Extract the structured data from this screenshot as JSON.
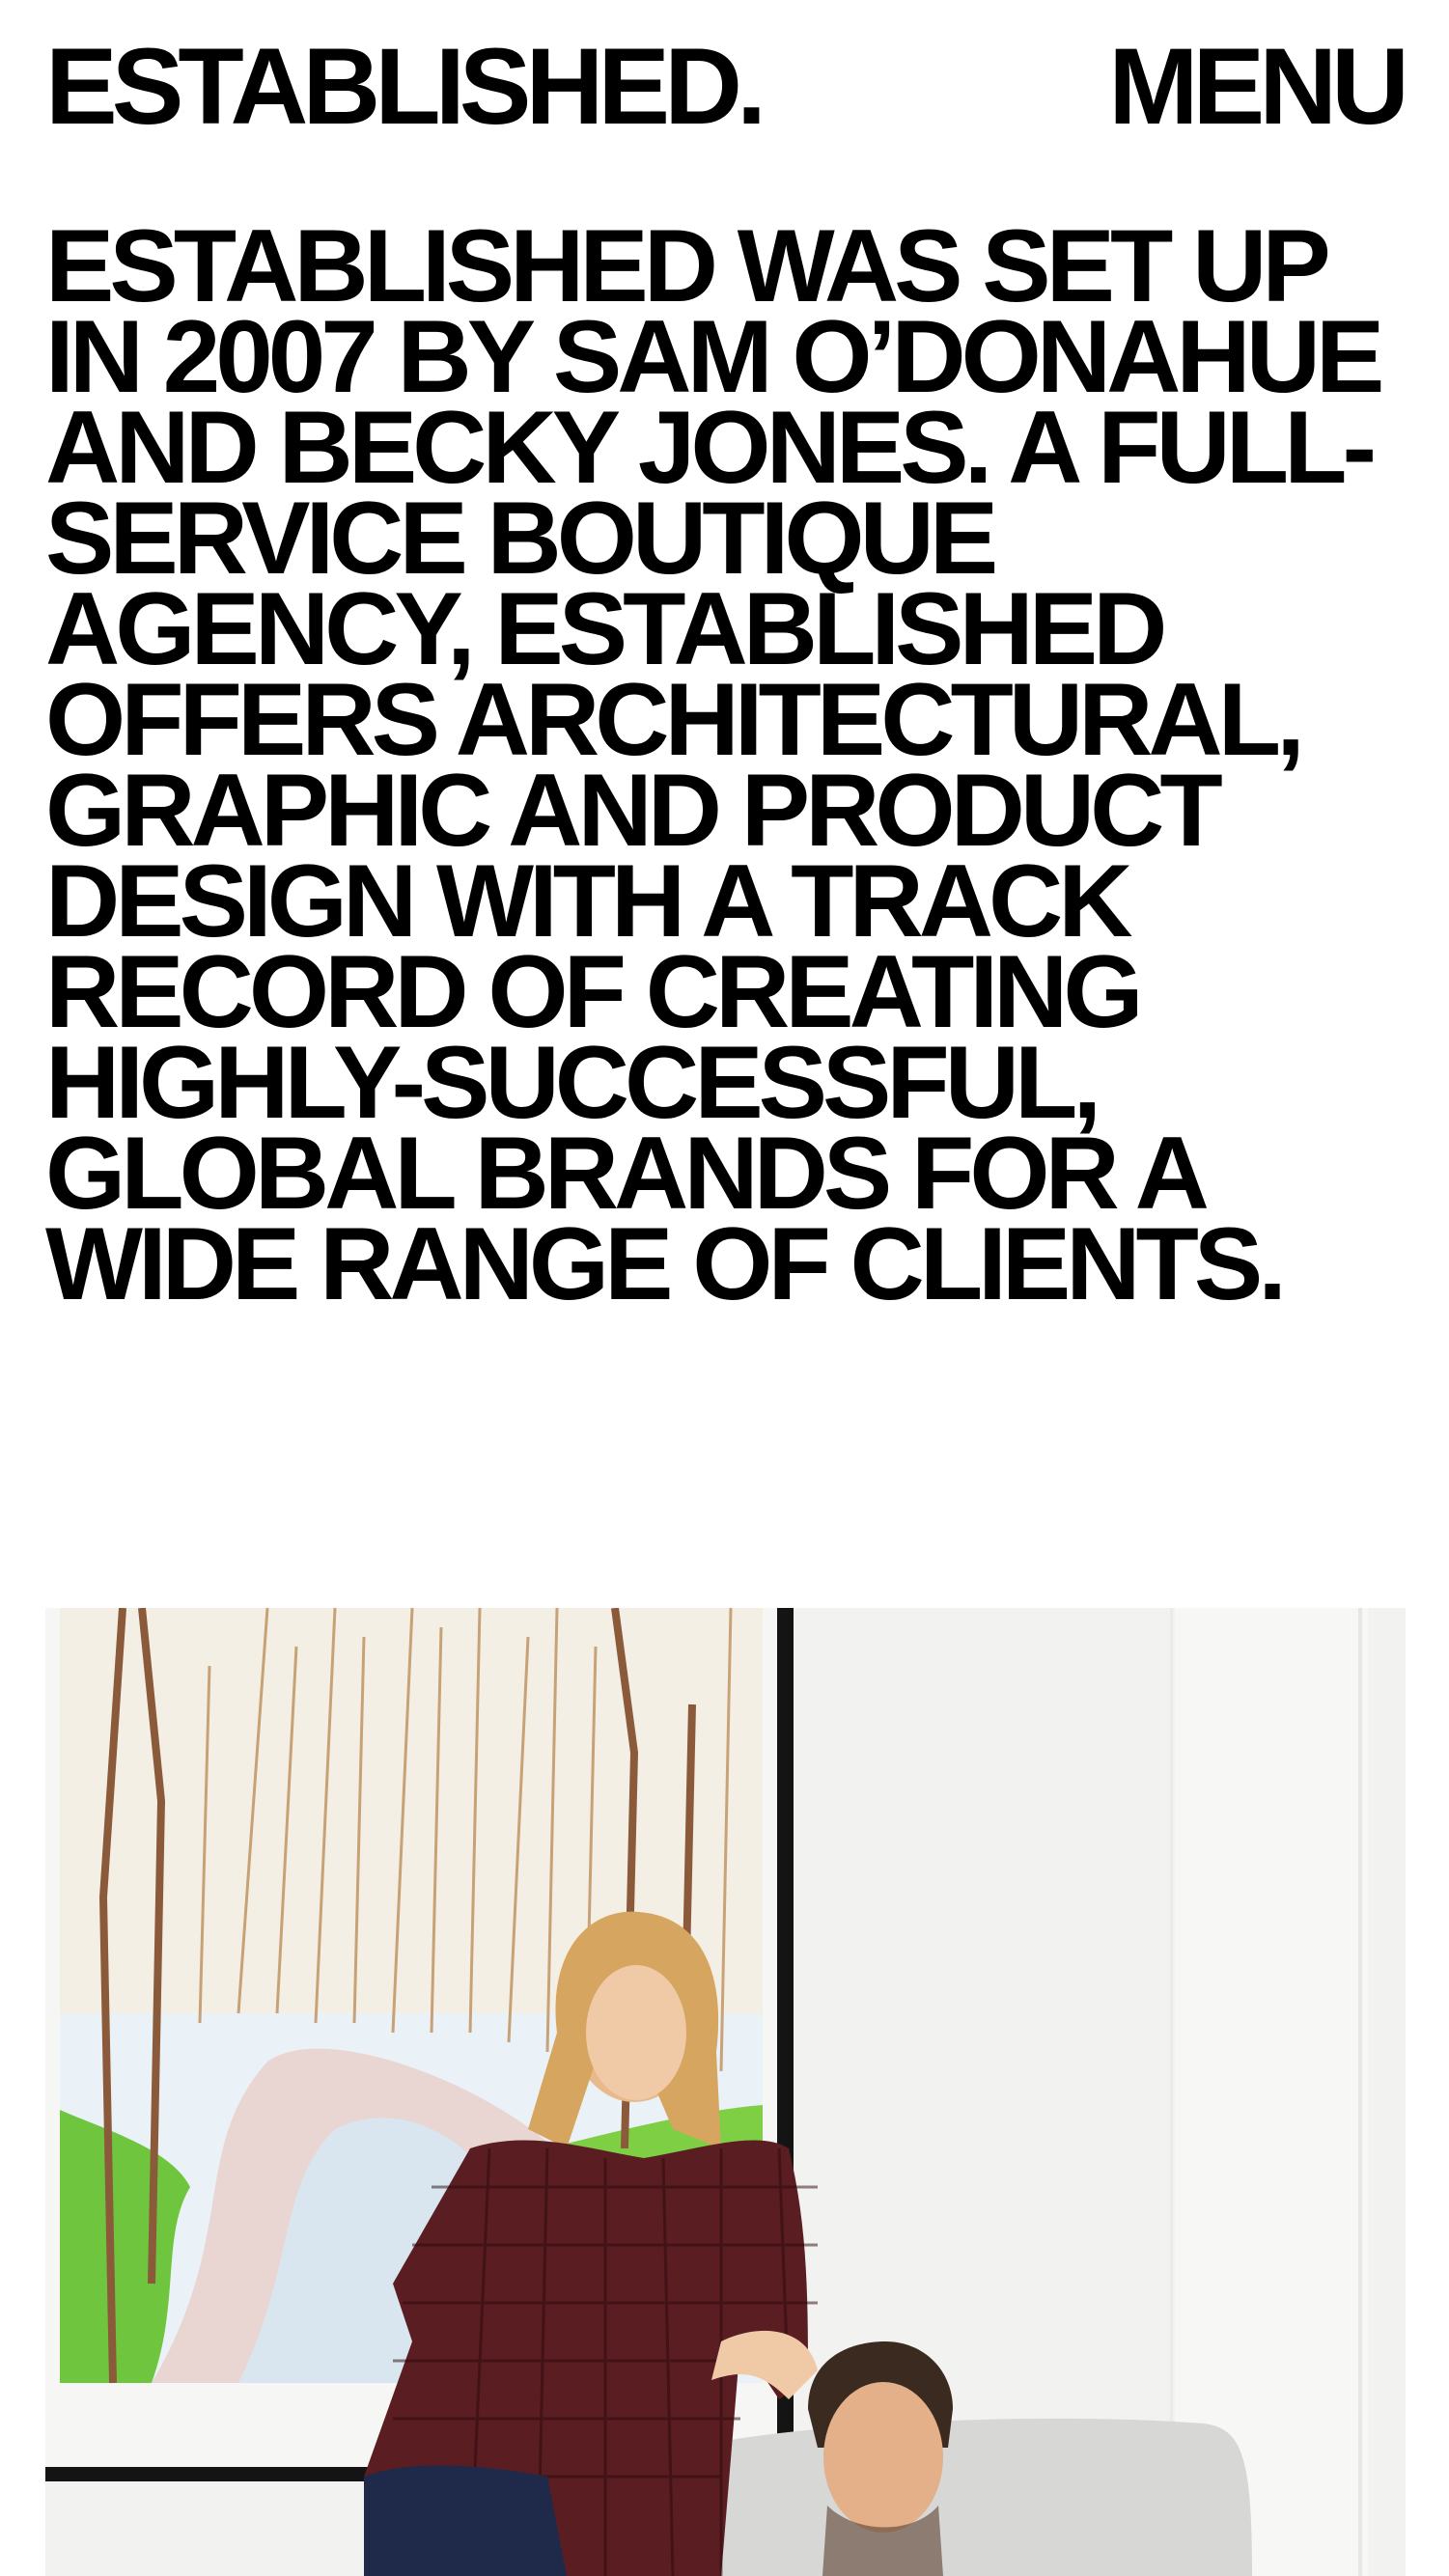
{
  "header": {
    "logo": "ESTABLISHED.",
    "menu_label": "MENU"
  },
  "intro": {
    "text": "ESTABLISHED WAS SET UP IN 2007 BY SAM O’DONAHUE AND BECKY JONES. A FULL-SERVICE BOUTIQUE AGENCY, ESTABLISHED OFFERS ARCHITECTURAL, GRAPHIC AND PRODUCT DESIGN WITH A TRACK RECORD OF CREATING HIGHLY-SUCCESSFUL, GLOBAL BRANDS FOR A WIDE RANGE OF CLIENTS."
  },
  "colors": {
    "background": "#ffffff",
    "text": "#000000"
  }
}
